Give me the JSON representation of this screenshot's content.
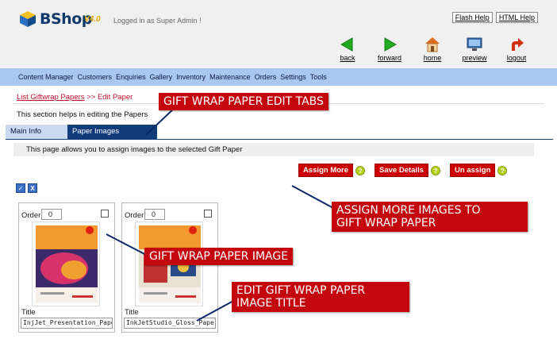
{
  "app": {
    "name": "BShop",
    "version": "V4.0",
    "logged_in_text": "Logged in as Super Admin !"
  },
  "help_links": {
    "flash_help": "Flash Help",
    "html_help": "HTML Help"
  },
  "nav_icons": [
    {
      "label": "back",
      "icon": "back-arrow-icon",
      "color": "#22aa22"
    },
    {
      "label": "forward",
      "icon": "forward-arrow-icon",
      "color": "#22aa22"
    },
    {
      "label": "home",
      "icon": "home-icon",
      "color": "#e06a20"
    },
    {
      "label": "preview",
      "icon": "monitor-icon",
      "color": "#3a6fb0"
    },
    {
      "label": "logout",
      "icon": "logout-arrow-icon",
      "color": "#d03010"
    }
  ],
  "menu": [
    "Content Manager",
    "Customers",
    "Enquiries",
    "Gallery",
    "Inventory",
    "Maintenance",
    "Orders",
    "Settings",
    "Tools"
  ],
  "breadcrumb": {
    "link": "List Giftwrap Papers",
    "separator": ">>",
    "current": "Edit Paper"
  },
  "section_help": "This section helps in editing the Papers",
  "tabs": [
    {
      "label": "Main Info",
      "active": false
    },
    {
      "label": "Paper Images",
      "active": true
    }
  ],
  "info_bar": "This page allows you to assign images to the selected Gift Paper",
  "actions": [
    {
      "label": "Assign More"
    },
    {
      "label": "Save Details"
    },
    {
      "label": "Un assign"
    }
  ],
  "help_glyph": "?",
  "mini_buttons": {
    "check": "✓",
    "close": "X"
  },
  "cards": [
    {
      "order_label": "Order",
      "order_value": "0",
      "title_label": "Title",
      "title_value": "InjJet_Presentation_Paper_M",
      "thumb_heading": "Kromekote Inkjet Presentation Paper"
    },
    {
      "order_label": "Order",
      "order_value": "0",
      "title_label": "Title",
      "title_value": "InkJetStudio_Gloss_Paper",
      "thumb_heading": "Kromekote Inkjet Studio Picture Paper"
    }
  ],
  "callouts": {
    "tabs": "GIFT WRAP PAPER EDIT TABS",
    "assign_line1": "ASSIGN MORE IMAGES TO",
    "assign_line2": "GIFT WRAP PAPER",
    "image": "GIFT WRAP PAPER IMAGE",
    "title_line1": "EDIT GIFT WRAP PAPER",
    "title_line2": "IMAGE TITLE"
  },
  "colors": {
    "menu_bg": "#a9c8ef",
    "active_tab": "#123b7a",
    "action_red": "#cc0000",
    "callout_red": "#c4060f",
    "help_green": "#b6d01a"
  }
}
